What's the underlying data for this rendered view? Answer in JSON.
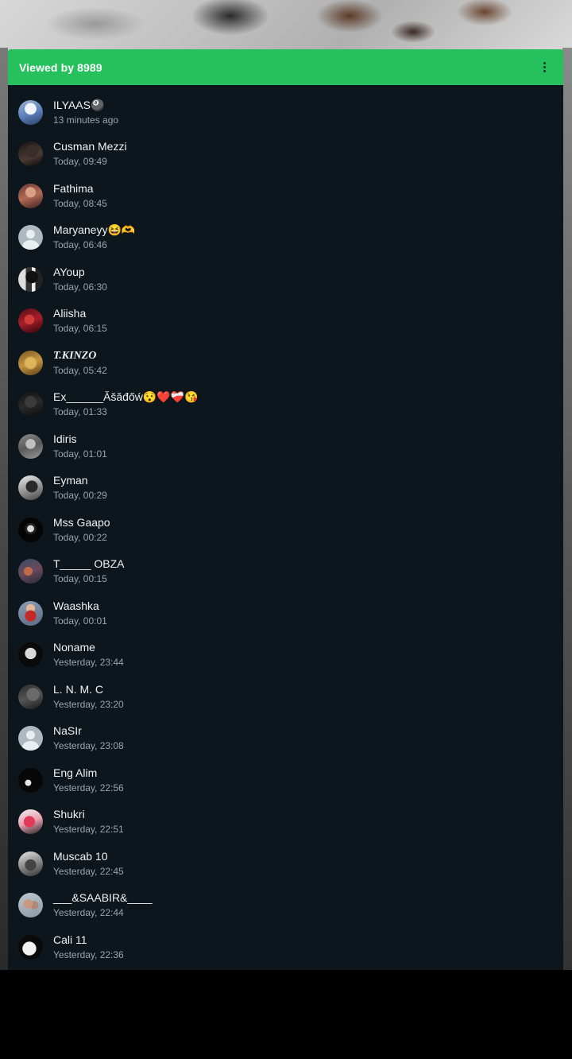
{
  "header": {
    "title": "Viewed by 8989",
    "menu_icon": "more-vert-icon"
  },
  "colors": {
    "accent": "#26c15d",
    "sheet_bg": "#0d161c",
    "name": "#f0f2f3",
    "time": "#9aa5ab"
  },
  "viewers": [
    {
      "name": "ILYAAS🎱",
      "time": "13 minutes ago",
      "avatar": "a1"
    },
    {
      "name": "Cusman Mezzi",
      "time": "Today, 09:49",
      "avatar": "a2"
    },
    {
      "name": "Fathima",
      "time": "Today, 08:45",
      "avatar": "a3"
    },
    {
      "name": "Maryaneyy😆🫶",
      "time": "Today, 06:46",
      "avatar": "default"
    },
    {
      "name": "AYoup",
      "time": "Today, 06:30",
      "avatar": "a5"
    },
    {
      "name": "Aliisha",
      "time": "Today, 06:15",
      "avatar": "a6"
    },
    {
      "name": "T.KINZO",
      "time": "Today, 05:42",
      "avatar": "a7"
    },
    {
      "name": "Ex______Ăšăđőẃ😯❤️❤️‍🩹😘",
      "time": "Today, 01:33",
      "avatar": "a8"
    },
    {
      "name": "Idiris",
      "time": "Today, 01:01",
      "avatar": "a9"
    },
    {
      "name": "Eyman",
      "time": "Today, 00:29",
      "avatar": "a10"
    },
    {
      "name": "Mss Gaapo",
      "time": "Today, 00:22",
      "avatar": "a11"
    },
    {
      "name": "T_____ OBZA",
      "time": "Today, 00:15",
      "avatar": "a12"
    },
    {
      "name": "Waashka",
      "time": "Today, 00:01",
      "avatar": "a13"
    },
    {
      "name": "Noname",
      "time": "Yesterday, 23:44",
      "avatar": "a14"
    },
    {
      "name": "L. N. M. C",
      "time": "Yesterday, 23:20",
      "avatar": "a15"
    },
    {
      "name": "NaSIr",
      "time": "Yesterday, 23:08",
      "avatar": "default"
    },
    {
      "name": "Eng Alim",
      "time": "Yesterday, 22:56",
      "avatar": "a17"
    },
    {
      "name": "Shukri",
      "time": "Yesterday, 22:51",
      "avatar": "a18"
    },
    {
      "name": "Muscab 10",
      "time": "Yesterday, 22:45",
      "avatar": "a19"
    },
    {
      "name": "___&SAABIR&____",
      "time": "Yesterday, 22:44",
      "avatar": "a20"
    },
    {
      "name": "Cali 11",
      "time": "Yesterday, 22:36",
      "avatar": "a21"
    }
  ]
}
